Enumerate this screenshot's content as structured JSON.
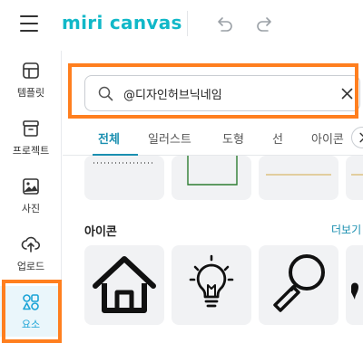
{
  "app": {
    "logo_text": "miri canvas",
    "brand_color": "#11b8c8",
    "accent_color": "#ff7f1f"
  },
  "toolbar": {
    "menu_icon": "hamburger-icon",
    "undo_icon": "undo-icon",
    "redo_icon": "redo-icon"
  },
  "sidebar": {
    "items": [
      {
        "label": "템플릿",
        "icon": "template-icon"
      },
      {
        "label": "프로젝트",
        "icon": "project-icon"
      },
      {
        "label": "사진",
        "icon": "photo-icon"
      },
      {
        "label": "업로드",
        "icon": "upload-icon"
      },
      {
        "label": "요소",
        "icon": "elements-icon",
        "active": true
      }
    ]
  },
  "search": {
    "value": "@디자인허브닉네임",
    "search_icon": "search-icon",
    "clear_icon": "close-icon"
  },
  "tabs": [
    {
      "label": "전체",
      "active": true
    },
    {
      "label": "일러스트"
    },
    {
      "label": "도형"
    },
    {
      "label": "선"
    },
    {
      "label": "아이콘"
    }
  ],
  "icons_section": {
    "title": "아이콘",
    "more_label": "더보기",
    "items": [
      "house-icon",
      "lightbulb-icon",
      "magnifier-icon",
      "partial-icon"
    ]
  }
}
